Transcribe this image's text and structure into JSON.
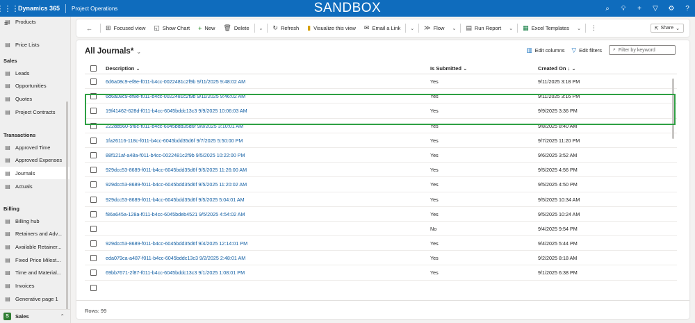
{
  "topbar": {
    "app_name": "Dynamics 365",
    "module": "Project Operations",
    "environment": "SANDBOX"
  },
  "sidebar": {
    "partial_item": {
      "label": "Products",
      "icon": "box-icon"
    },
    "top_items": [
      {
        "label": "Price Lists",
        "icon": "list-icon"
      }
    ],
    "groups": [
      {
        "title": "Sales",
        "items": [
          {
            "label": "Leads",
            "icon": "lead-icon"
          },
          {
            "label": "Opportunities",
            "icon": "opportunity-icon"
          },
          {
            "label": "Quotes",
            "icon": "quote-icon"
          },
          {
            "label": "Project Contracts",
            "icon": "contract-icon"
          }
        ]
      },
      {
        "title": "Transactions",
        "items": [
          {
            "label": "Approved Time",
            "icon": "calendar-icon"
          },
          {
            "label": "Approved Expenses",
            "icon": "expense-icon"
          },
          {
            "label": "Journals",
            "icon": "journal-icon",
            "active": true
          },
          {
            "label": "Actuals",
            "icon": "actuals-icon"
          }
        ]
      },
      {
        "title": "Billing",
        "items": [
          {
            "label": "Billing hub",
            "icon": "billing-hub-icon"
          },
          {
            "label": "Retainers and Adv...",
            "icon": "retainer-icon"
          },
          {
            "label": "Available Retainer...",
            "icon": "available-retainer-icon"
          },
          {
            "label": "Fixed Price Milest...",
            "icon": "milestone-icon"
          },
          {
            "label": "Time and Material...",
            "icon": "time-material-icon"
          },
          {
            "label": "Invoices",
            "icon": "invoice-icon"
          },
          {
            "label": "Generative page 1",
            "icon": "generative-page-icon"
          }
        ]
      }
    ],
    "area": {
      "badge": "S",
      "name": "Sales"
    }
  },
  "commandbar": {
    "focused_view": "Focused view",
    "show_chart": "Show Chart",
    "new": "New",
    "delete": "Delete",
    "refresh": "Refresh",
    "visualize": "Visualize this view",
    "email_link": "Email a Link",
    "flow": "Flow",
    "run_report": "Run Report",
    "excel_templates": "Excel Templates",
    "share": "Share"
  },
  "view": {
    "title": "All Journals*",
    "edit_columns": "Edit columns",
    "edit_filters": "Edit filters",
    "filter_placeholder": "Filter by keyword"
  },
  "grid": {
    "columns": {
      "description": "Description",
      "submitted": "Is Submitted",
      "created_on": "Created On"
    },
    "rows": [
      {
        "description": "6d6a08c9-ef8e-f011-b4cc-0022481c2f9b 9/11/2025 9:48:02 AM",
        "submitted": "Yes",
        "created_on": "9/11/2025 3:18 PM"
      },
      {
        "description": "6d6a08c9-ef8e-f011-b4cc-0022481c2f9b 9/11/2025 9:46:02 AM",
        "submitted": "Yes",
        "created_on": "9/11/2025 3:16 PM"
      },
      {
        "description": "19f41462-628d-f011-b4cc-6045bddc13c3 9/9/2025 10:06:03 AM",
        "submitted": "Yes",
        "created_on": "9/9/2025 3:36 PM"
      },
      {
        "description": "222dd560-5f8c-f011-b4cc-6045bdd35d6f 9/8/2025 3:10:01 AM",
        "submitted": "Yes",
        "created_on": "9/8/2025 8:40 AM"
      },
      {
        "description": "1fa26116-118c-f011-b4cc-6045bdd35d6f 9/7/2025 5:50:00 PM",
        "submitted": "Yes",
        "created_on": "9/7/2025 11:20 PM"
      },
      {
        "description": "88f121af-a48a-f011-b4cc-0022481c2f9b 9/5/2025 10:22:00 PM",
        "submitted": "Yes",
        "created_on": "9/6/2025 3:52 AM"
      },
      {
        "description": "929dcc53-8689-f011-b4cc-6045bdd35d6f 9/5/2025 11:26:00 AM",
        "submitted": "Yes",
        "created_on": "9/5/2025 4:56 PM"
      },
      {
        "description": "929dcc53-8689-f011-b4cc-6045bdd35d6f 9/5/2025 11:20:02 AM",
        "submitted": "Yes",
        "created_on": "9/5/2025 4:50 PM"
      },
      {
        "description": "929dcc53-8689-f011-b4cc-6045bdd35d6f 9/5/2025 5:04:01 AM",
        "submitted": "Yes",
        "created_on": "9/5/2025 10:34 AM"
      },
      {
        "description": "f86a645a-128a-f011-b4cc-6045bdeb4521 9/5/2025 4:54:02 AM",
        "submitted": "Yes",
        "created_on": "9/5/2025 10:24 AM"
      },
      {
        "description": "",
        "submitted": "No",
        "created_on": "9/4/2025 9:54 PM"
      },
      {
        "description": "929dcc53-8689-f011-b4cc-6045bdd35d6f 9/4/2025 12:14:01 PM",
        "submitted": "Yes",
        "created_on": "9/4/2025 5:44 PM"
      },
      {
        "description": "eda079ca-a487-f011-b4cc-6045bddc13c3 9/2/2025 2:48:01 AM",
        "submitted": "Yes",
        "created_on": "9/2/2025 8:18 AM"
      },
      {
        "description": "69bb7671-2f87-f011-b4cc-6045bddc13c3 9/1/2025 1:08:01 PM",
        "submitted": "Yes",
        "created_on": "9/1/2025 6:38 PM"
      }
    ],
    "row_count": "Rows: 99"
  },
  "colors": {
    "brand": "#0f6cbd",
    "highlight_border": "#2ea043",
    "link": "#115ea3"
  }
}
